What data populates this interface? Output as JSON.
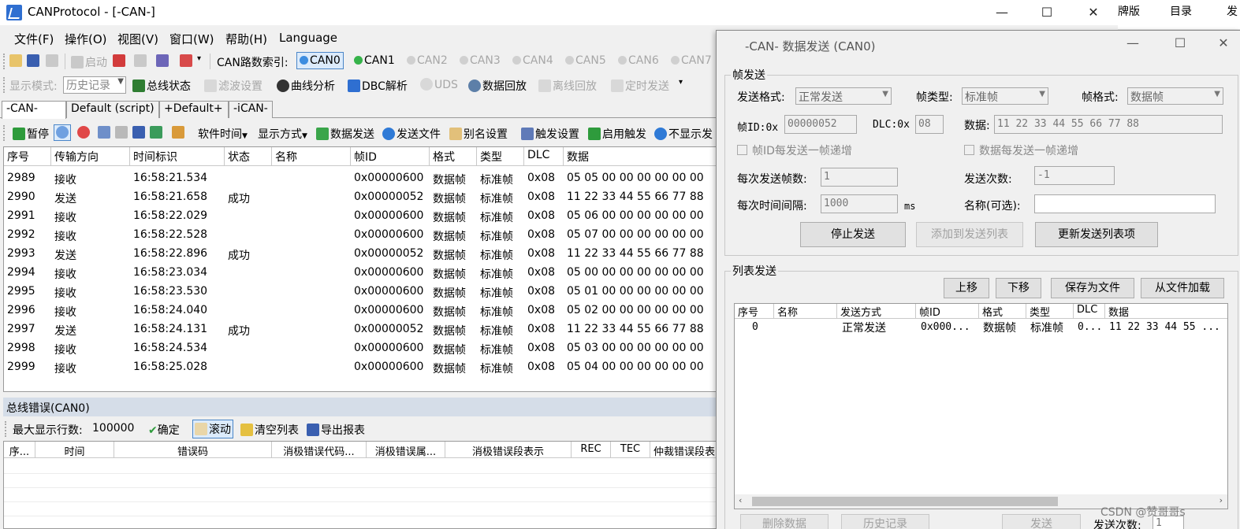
{
  "window": {
    "title": "CANProtocol - [-CAN-]",
    "minimize": "—",
    "maximize": "☐",
    "close": "✕"
  },
  "background_window": {
    "labels": [
      "牌版",
      "目录",
      "发"
    ]
  },
  "menu": [
    "文件(F)",
    "操作(O)",
    "视图(V)",
    "窗口(W)",
    "帮助(H)",
    "Language"
  ],
  "toolbar1": {
    "start": "启动",
    "can_index_label": "CAN路数索引:",
    "channels": [
      "CAN0",
      "CAN1",
      "CAN2",
      "CAN3",
      "CAN4",
      "CAN5",
      "CAN6",
      "CAN7"
    ]
  },
  "toolbar2": {
    "display_mode_label": "显示模式:",
    "display_mode_value": "历史记录",
    "bus_status": "总线状态",
    "filter": "滤波设置",
    "curve": "曲线分析",
    "dbc": "DBC解析",
    "uds": "UDS",
    "replay": "数据回放",
    "offline_replay": "离线回放",
    "timed_send": "定时发送"
  },
  "tabs": [
    "-CAN-",
    "Default (script)",
    "+Default+",
    "-iCAN-"
  ],
  "toolbar3": {
    "pause": "暂停",
    "software_time": "软件时间",
    "display_method": "显示方式",
    "data_send": "数据发送",
    "send_file": "发送文件",
    "alias": "别名设置",
    "trigger_setup": "触发设置",
    "enable_trigger": "启用触发",
    "hide": "不显示发"
  },
  "grid": {
    "columns": [
      "序号",
      "传输方向",
      "时间标识",
      "状态",
      "名称",
      "帧ID",
      "格式",
      "类型",
      "DLC",
      "数据"
    ],
    "rows": [
      [
        "2989",
        "接收",
        "16:58:21.534",
        "",
        "",
        "0x00000600",
        "数据帧",
        "标准帧",
        "0x08",
        "05 05 00 00 00 00 00 00"
      ],
      [
        "2990",
        "发送",
        "16:58:21.658",
        "成功",
        "",
        "0x00000052",
        "数据帧",
        "标准帧",
        "0x08",
        "11 22 33 44 55 66 77 88"
      ],
      [
        "2991",
        "接收",
        "16:58:22.029",
        "",
        "",
        "0x00000600",
        "数据帧",
        "标准帧",
        "0x08",
        "05 06 00 00 00 00 00 00"
      ],
      [
        "2992",
        "接收",
        "16:58:22.528",
        "",
        "",
        "0x00000600",
        "数据帧",
        "标准帧",
        "0x08",
        "05 07 00 00 00 00 00 00"
      ],
      [
        "2993",
        "发送",
        "16:58:22.896",
        "成功",
        "",
        "0x00000052",
        "数据帧",
        "标准帧",
        "0x08",
        "11 22 33 44 55 66 77 88"
      ],
      [
        "2994",
        "接收",
        "16:58:23.034",
        "",
        "",
        "0x00000600",
        "数据帧",
        "标准帧",
        "0x08",
        "05 00 00 00 00 00 00 00"
      ],
      [
        "2995",
        "接收",
        "16:58:23.530",
        "",
        "",
        "0x00000600",
        "数据帧",
        "标准帧",
        "0x08",
        "05 01 00 00 00 00 00 00"
      ],
      [
        "2996",
        "接收",
        "16:58:24.040",
        "",
        "",
        "0x00000600",
        "数据帧",
        "标准帧",
        "0x08",
        "05 02 00 00 00 00 00 00"
      ],
      [
        "2997",
        "发送",
        "16:58:24.131",
        "成功",
        "",
        "0x00000052",
        "数据帧",
        "标准帧",
        "0x08",
        "11 22 33 44 55 66 77 88"
      ],
      [
        "2998",
        "接收",
        "16:58:24.534",
        "",
        "",
        "0x00000600",
        "数据帧",
        "标准帧",
        "0x08",
        "05 03 00 00 00 00 00 00"
      ],
      [
        "2999",
        "接收",
        "16:58:25.028",
        "",
        "",
        "0x00000600",
        "数据帧",
        "标准帧",
        "0x08",
        "05 04 00 00 00 00 00 00"
      ]
    ]
  },
  "bus_error": {
    "title": "总线错误(CAN0)",
    "max_rows_label": "最大显示行数:",
    "max_rows_value": "100000",
    "confirm": "确定",
    "scroll": "滚动",
    "clear": "清空列表",
    "export": "导出报表",
    "columns": [
      "序...",
      "时间",
      "错误码",
      "消极错误代码...",
      "消极错误属...",
      "消极错误段表示",
      "REC",
      "TEC",
      "仲裁错误段表"
    ]
  },
  "dialog": {
    "title": "-CAN- 数据发送 (CAN0)",
    "frame_send_group": "帧发送",
    "send_format_label": "发送格式:",
    "send_format_value": "正常发送",
    "frame_type_label": "帧类型:",
    "frame_type_value": "标准帧",
    "frame_format_label": "帧格式:",
    "frame_format_value": "数据帧",
    "frame_id_label": "帧ID:0x",
    "frame_id_value": "00000052",
    "dlc_label": "DLC:0x",
    "dlc_value": "08",
    "data_label": "数据:",
    "data_value": "11 22 33 44 55 66 77 88",
    "id_increment": "帧ID每发送一帧递增",
    "data_increment": "数据每发送一帧递增",
    "frames_per_send_label": "每次发送帧数:",
    "frames_per_send_value": "1",
    "send_count_label": "发送次数:",
    "send_count_value": "-1",
    "interval_label": "每次时间间隔:",
    "interval_value": "1000",
    "interval_unit": "ms",
    "name_label": "名称(可选):",
    "name_value": "",
    "stop_send": "停止发送",
    "add_to_list": "添加到发送列表",
    "update_list_item": "更新发送列表项",
    "list_send_group": "列表发送",
    "move_up": "上移",
    "move_down": "下移",
    "save_file": "保存为文件",
    "load_file": "从文件加载",
    "list_columns": [
      "序号",
      "名称",
      "发送方式",
      "帧ID",
      "格式",
      "类型",
      "DLC",
      "数据"
    ],
    "list_row": [
      "0",
      "",
      "正常发送",
      "0x000...",
      "数据帧",
      "标准帧",
      "0...",
      "11 22 33 44 55 ..."
    ],
    "delete_data": "删除数据",
    "history": "历史记录",
    "send": "发送",
    "send_count_bottom_label": "发送次数:",
    "send_count_bottom_value": "1"
  },
  "watermark": "CSDN @赞哥哥s"
}
